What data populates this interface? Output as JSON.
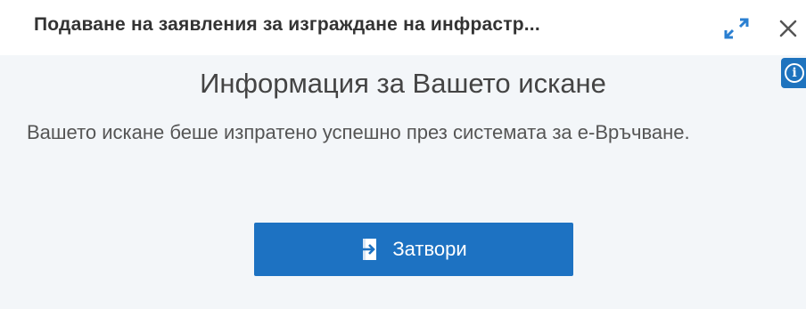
{
  "dialog": {
    "title": "Подаване на заявления за изграждане на инфрастр...",
    "heading": "Информация за Вашето искане",
    "message": "Вашето искане беше изпратено успешно през системата за е-Връчване.",
    "close_button_label": "Затвори",
    "info_badge_symbol": "i"
  },
  "icons": {
    "expand": "expand-icon",
    "close": "close-icon",
    "info": "info-icon",
    "exit": "exit-door-icon"
  },
  "colors": {
    "accent": "#1d72c2",
    "panel_background": "#f3f6f9",
    "title_text": "#333333"
  }
}
